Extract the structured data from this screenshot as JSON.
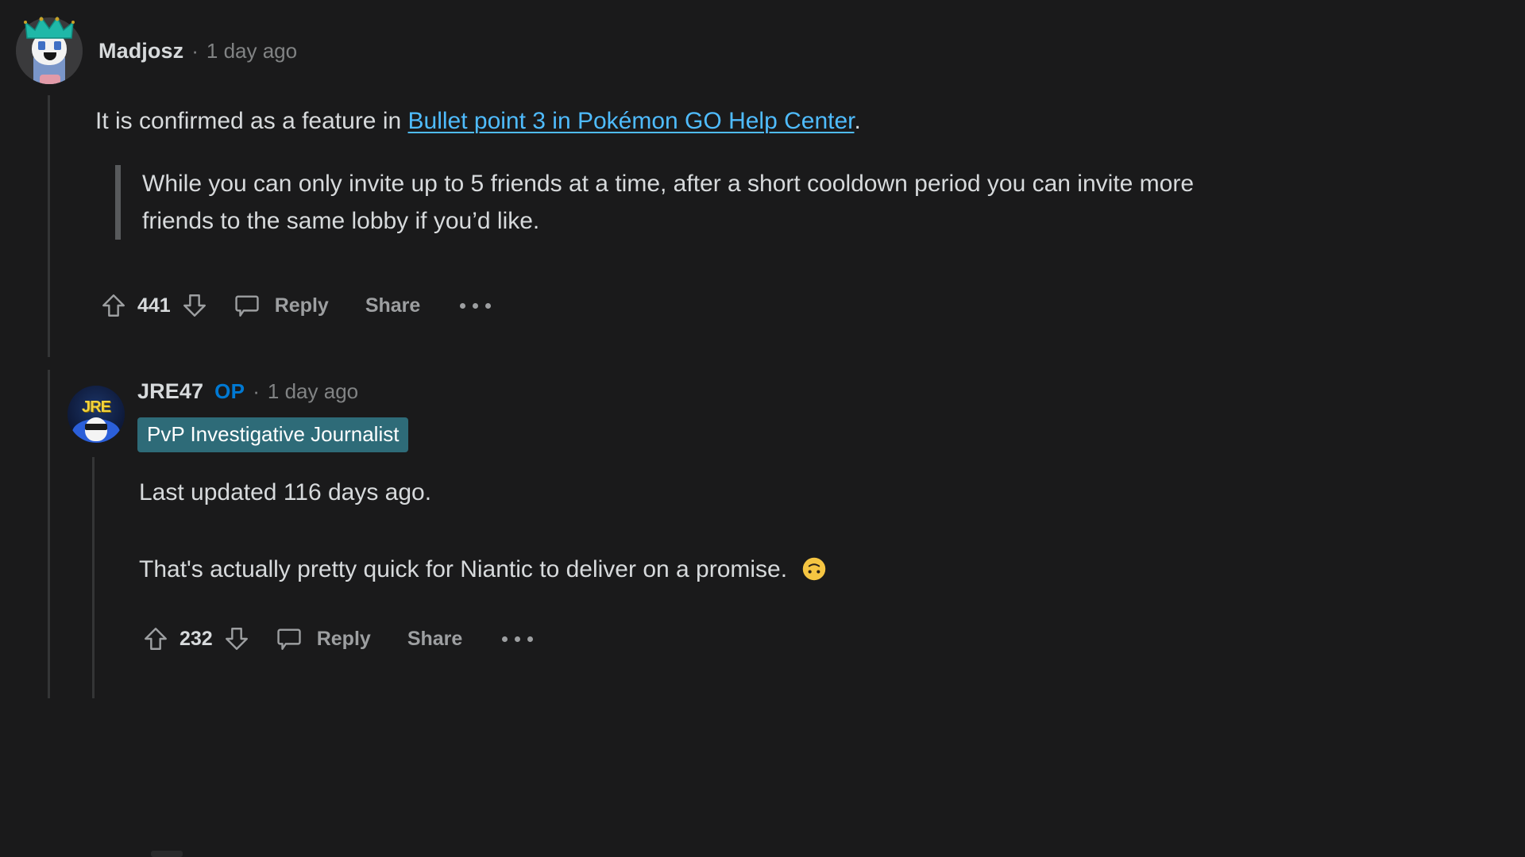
{
  "theme": {
    "background": "#1a1a1b",
    "text_primary": "#d7dadc",
    "text_muted": "#818384",
    "link": "#4fbcff",
    "op_blue": "#0079d3",
    "flair_bg": "#2e6b78",
    "thread_line": "#343536",
    "quote_bar": "#585a5c"
  },
  "comments": [
    {
      "author": "Madjosz",
      "separator": "·",
      "timestamp": "1 day ago",
      "body_before_link": "It is confirmed as a feature in ",
      "link_text": "Bullet point 3 in Pokémon GO Help Center",
      "body_after_link": ".",
      "quote": "While you can only invite up to 5 friends at a time, after a short cooldown period you can invite more friends to the same lobby if you’d like.",
      "actions": {
        "upvote_icon": "upvote-arrow-icon",
        "vote_count": "441",
        "downvote_icon": "downvote-arrow-icon",
        "comment_icon": "comment-bubble-icon",
        "reply_label": "Reply",
        "share_label": "Share",
        "more_icon": "more-options-icon"
      },
      "avatar_name": "madjosz-snoo-avatar"
    },
    {
      "author": "JRE47",
      "op_badge": "OP",
      "separator": "·",
      "timestamp": "1 day ago",
      "flair": "PvP Investigative Journalist",
      "paragraph_1": "Last updated 116 days ago.",
      "paragraph_2": "That's actually pretty quick for Niantic to deliver on a promise.",
      "paragraph_2_emoji": "upside-down-face",
      "actions": {
        "upvote_icon": "upvote-arrow-icon",
        "vote_count": "232",
        "downvote_icon": "downvote-arrow-icon",
        "comment_icon": "comment-bubble-icon",
        "reply_label": "Reply",
        "share_label": "Share",
        "more_icon": "more-options-icon"
      },
      "avatar_name": "jre47-snoo-avatar"
    }
  ]
}
